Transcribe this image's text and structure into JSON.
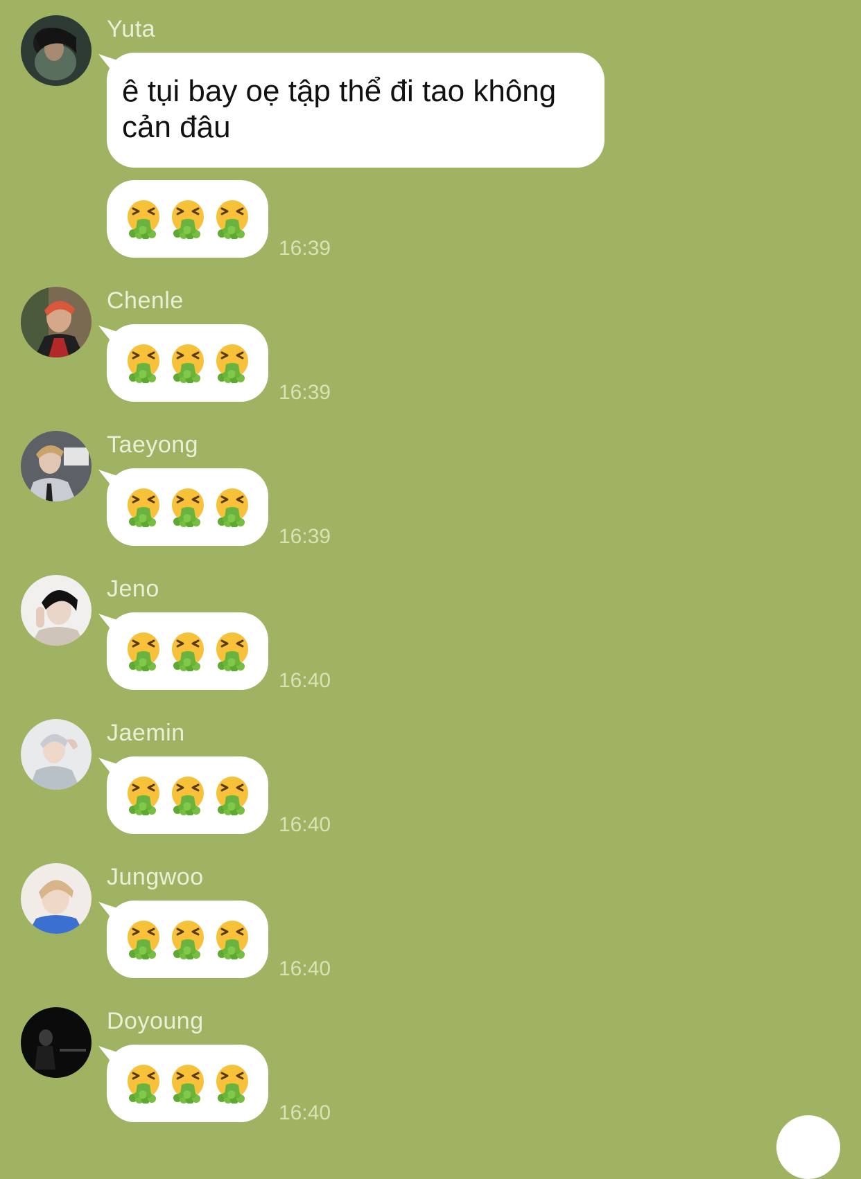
{
  "colors": {
    "chat_background": "#9fb363",
    "bubble": "#ffffff",
    "sender_name": "#eaf0d8",
    "timestamp": "#d8e3b4"
  },
  "emoji_icon": "face-vomiting-icon",
  "messages": [
    {
      "sender": "Yuta",
      "avatar_icon": "avatar-dark-hair",
      "text": "ê tụi bay oẹ tập thể đi tao không cản đâu"
    },
    {
      "sender": "Yuta",
      "emoji_count": 3,
      "time": "16:39"
    },
    {
      "sender": "Chenle",
      "avatar_icon": "avatar-red-hair",
      "emoji_count": 3,
      "time": "16:39"
    },
    {
      "sender": "Taeyong",
      "avatar_icon": "avatar-suit",
      "emoji_count": 3,
      "time": "16:39"
    },
    {
      "sender": "Jeno",
      "avatar_icon": "avatar-black-hair",
      "emoji_count": 3,
      "time": "16:40"
    },
    {
      "sender": "Jaemin",
      "avatar_icon": "avatar-silver-hair",
      "emoji_count": 3,
      "time": "16:40"
    },
    {
      "sender": "Jungwoo",
      "avatar_icon": "avatar-light-hair",
      "emoji_count": 3,
      "time": "16:40"
    },
    {
      "sender": "Doyoung",
      "avatar_icon": "avatar-dark-photo",
      "emoji_count": 3,
      "time": "16:40"
    }
  ]
}
